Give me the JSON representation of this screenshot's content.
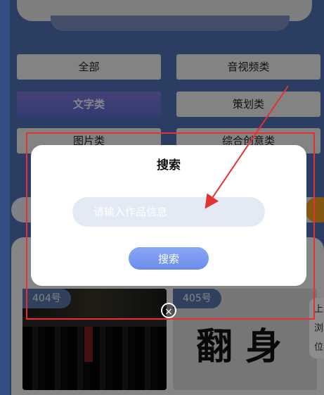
{
  "categories": [
    {
      "label": "全部"
    },
    {
      "label": "音视频类"
    },
    {
      "label": "文字类"
    },
    {
      "label": "策划类"
    },
    {
      "label": "图片类"
    },
    {
      "label": "综合创意类"
    }
  ],
  "active_category": "文字类",
  "modal": {
    "title": "搜索",
    "input_placeholder": "请输入作品信息",
    "search_button": "搜索"
  },
  "works": [
    {
      "badge": "404号"
    },
    {
      "badge": "405号",
      "calligraphy": "翻身"
    }
  ],
  "close_icon": "×",
  "side_tab": {
    "lines": [
      "上",
      "浏",
      "位"
    ]
  },
  "colors": {
    "accent": "#6c8ceb",
    "highlight": "#e43131",
    "page_bg": "#4f6fb3"
  }
}
